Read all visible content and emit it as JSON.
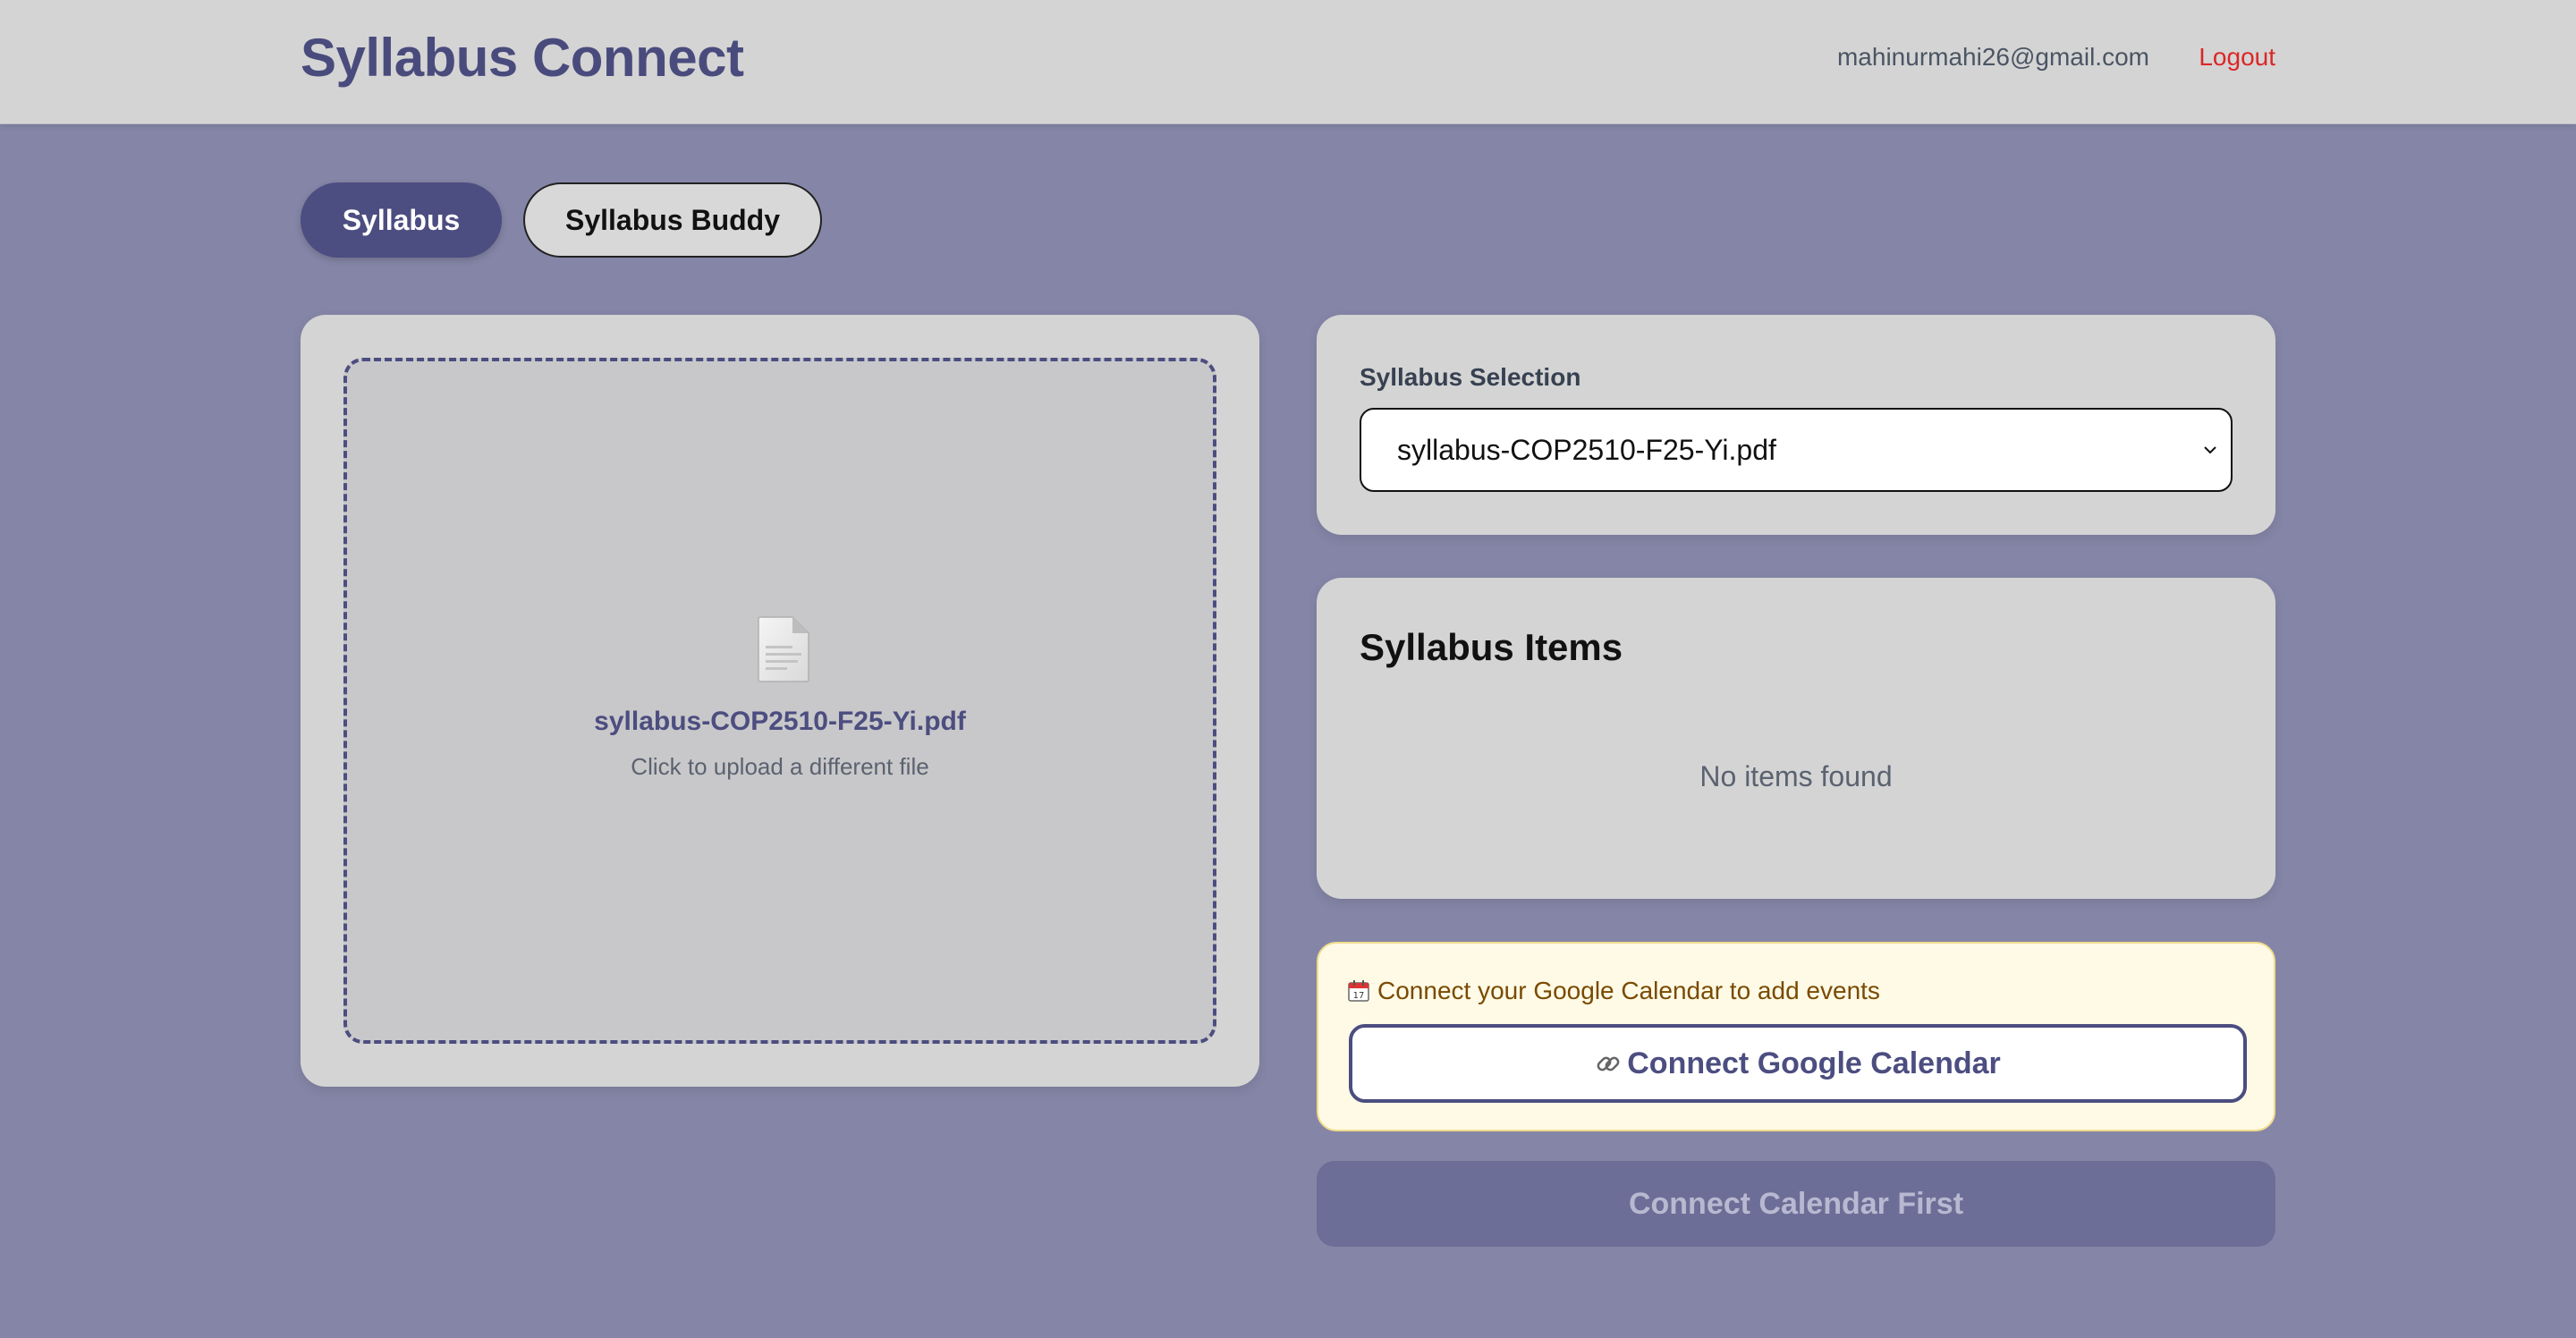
{
  "header": {
    "title": "Syllabus Connect",
    "user_email": "mahinurmahi26@gmail.com",
    "logout_label": "Logout"
  },
  "tabs": [
    {
      "label": "Syllabus",
      "active": true
    },
    {
      "label": "Syllabus Buddy",
      "active": false
    }
  ],
  "upload": {
    "file_name": "syllabus-COP2510-F25-Yi.pdf",
    "hint": "Click to upload a different file",
    "icon": "file-icon"
  },
  "selection": {
    "label": "Syllabus Selection",
    "selected": "syllabus-COP2510-F25-Yi.pdf"
  },
  "items": {
    "title": "Syllabus Items",
    "empty_text": "No items found"
  },
  "calendar": {
    "note": "Connect your Google Calendar to add events",
    "connect_label": "Connect Google Calendar",
    "disabled_label": "Connect Calendar First",
    "note_icon": "calendar-icon",
    "button_icon": "link-icon"
  },
  "colors": {
    "background": "#8586a7",
    "header": "#d4d4d4",
    "accent": "#4c4d80",
    "logout": "#dc2626",
    "notice_bg": "#fefae6",
    "disabled_btn": "#6d6e97"
  }
}
